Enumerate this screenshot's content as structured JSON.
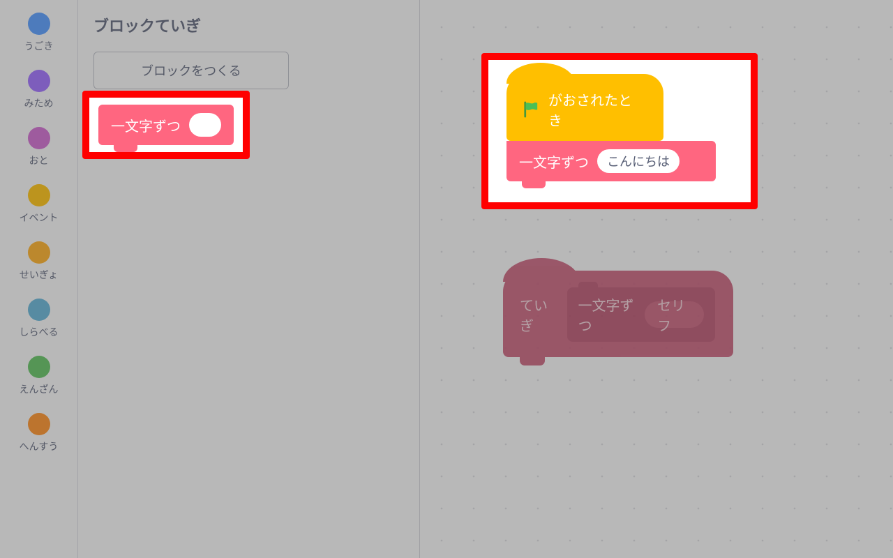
{
  "categories": [
    {
      "label": "うごき",
      "color": "#4c97ff"
    },
    {
      "label": "みため",
      "color": "#9966ff"
    },
    {
      "label": "おと",
      "color": "#cf63cf"
    },
    {
      "label": "イベント",
      "color": "#ffbf00"
    },
    {
      "label": "せいぎょ",
      "color": "#ffab19"
    },
    {
      "label": "しらべる",
      "color": "#5cb1d6"
    },
    {
      "label": "えんざん",
      "color": "#59c059"
    },
    {
      "label": "へんすう",
      "color": "#ff8c1a"
    }
  ],
  "palette": {
    "title": "ブロックていぎ",
    "make_button": "ブロックをつくる",
    "sample_block": {
      "label": "一文字ずつ",
      "arg": ""
    }
  },
  "workspace": {
    "hat": {
      "flag_color": "#45993d",
      "label": "がおされたとき"
    },
    "call_block": {
      "label": "一文字ずつ",
      "arg": "こんにちは"
    },
    "definition": {
      "prefix": "ていぎ",
      "proc_name": "一文字ずつ",
      "arg_name": "セリフ"
    }
  },
  "colors": {
    "highlight": "#ff0000",
    "custom_block": "#ff6680",
    "event_block": "#ffbf00",
    "definition_block": "#c24a6a"
  }
}
